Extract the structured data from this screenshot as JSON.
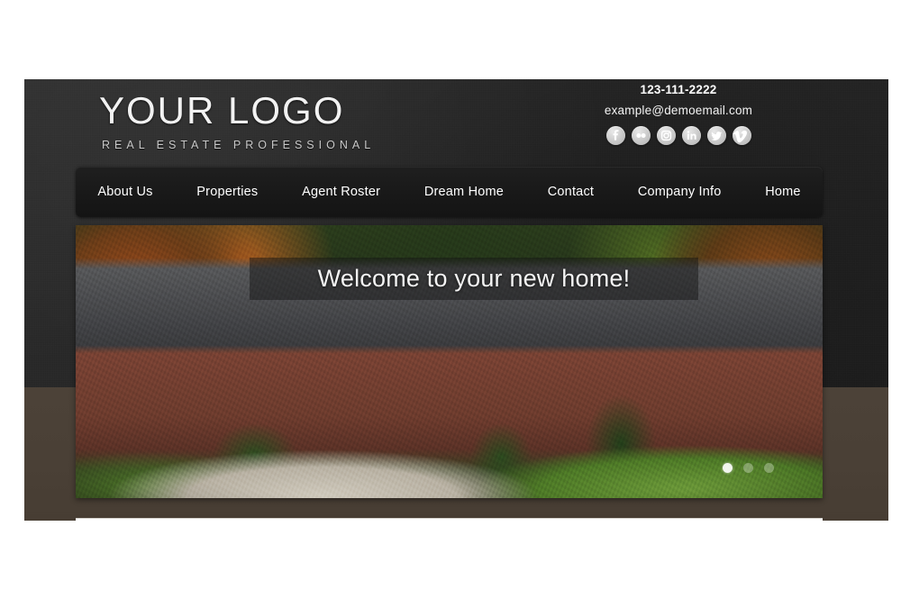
{
  "site": {
    "logo": {
      "title": "YOUR LOGO",
      "tagline": "REAL ESTATE PROFESSIONAL"
    },
    "contact": {
      "phone": "123-111-2222",
      "email": "example@demoemail.com"
    },
    "social": [
      {
        "name": "facebook-icon",
        "label": "Facebook"
      },
      {
        "name": "flickr-icon",
        "label": "Flickr"
      },
      {
        "name": "instagram-icon",
        "label": "Instagram"
      },
      {
        "name": "linkedin-icon",
        "label": "LinkedIn"
      },
      {
        "name": "twitter-icon",
        "label": "Twitter"
      },
      {
        "name": "vimeo-icon",
        "label": "Vimeo"
      }
    ],
    "nav": [
      {
        "label": "About Us"
      },
      {
        "label": "Properties"
      },
      {
        "label": "Agent Roster"
      },
      {
        "label": "Dream Home"
      },
      {
        "label": "Contact"
      },
      {
        "label": "Company Info"
      },
      {
        "label": "Home"
      }
    ],
    "hero": {
      "caption": "Welcome to your new home!",
      "slides": [
        {
          "active": true
        },
        {
          "active": false
        },
        {
          "active": false
        }
      ]
    },
    "colors": {
      "header_bg": "#262626",
      "nav_bg": "#191919",
      "body_band": "#4a4036",
      "logo_text": "#f2f2f2",
      "tagline_text": "#c9c9c9",
      "nav_text": "#ffffff",
      "caption_text": "#f4f4f4",
      "social_bubble": "#c9c9c9",
      "page_bg": "#ffffff"
    }
  }
}
